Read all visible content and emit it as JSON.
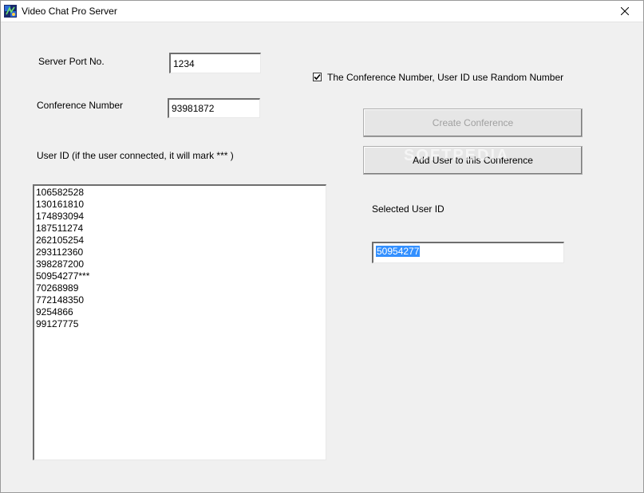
{
  "window": {
    "title": "Video Chat Pro Server",
    "icon": "app-icon",
    "close_glyph": "✕"
  },
  "form": {
    "server_port_label": "Server Port No.",
    "server_port_value": "1234",
    "conference_number_label": "Conference Number",
    "conference_number_value": "93981872",
    "random_checkbox_label": "The Conference Number, User ID use Random Number",
    "random_checkbox_checked": true,
    "user_id_label": "User ID  (if the user connected, it will mark *** )",
    "create_conference_label": "Create Conference",
    "add_user_label": "Add User to this Conference",
    "selected_user_label": "Selected User ID",
    "selected_user_value": "50954277"
  },
  "user_ids": [
    "106582528",
    "130161810",
    "174893094",
    "187511274",
    "262105254",
    "293112360",
    "398287200",
    "50954277***",
    "70268989",
    "772148350",
    "9254866",
    "99127775"
  ],
  "watermark": "SOFTPEDIA",
  "colors": {
    "selection": "#3390ff",
    "disabled_text": "#a0a0a0"
  }
}
